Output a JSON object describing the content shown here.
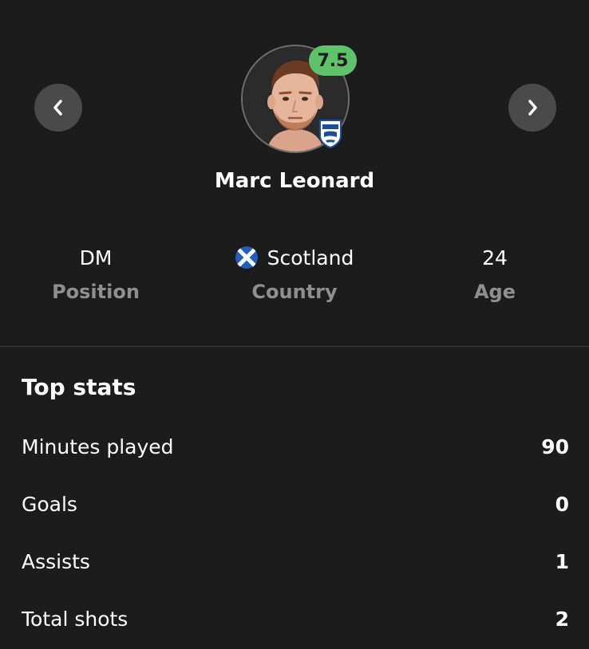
{
  "player": {
    "name": "Marc Leonard",
    "rating": "7.5",
    "rating_color": "#5ec26a"
  },
  "navigation": {
    "prev_icon": "chevron-left-icon",
    "next_icon": "chevron-right-icon"
  },
  "info": {
    "position": {
      "value": "DM",
      "label": "Position"
    },
    "country": {
      "value": "Scotland",
      "label": "Country",
      "flag_icon": "scotland-flag-icon"
    },
    "age": {
      "value": "24",
      "label": "Age"
    }
  },
  "top_stats": {
    "title": "Top stats",
    "rows": [
      {
        "label": "Minutes played",
        "value": "90"
      },
      {
        "label": "Goals",
        "value": "0"
      },
      {
        "label": "Assists",
        "value": "1"
      },
      {
        "label": "Total shots",
        "value": "2"
      }
    ]
  },
  "colors": {
    "background": "#1c1c1c",
    "muted_label": "#8f8f8f",
    "nav_button": "#4a4a4a",
    "divider": "#3d3d3d"
  }
}
